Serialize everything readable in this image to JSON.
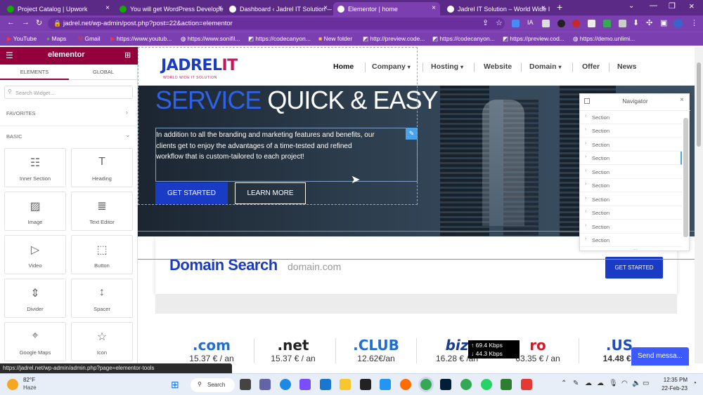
{
  "browser": {
    "tabs": [
      {
        "title": "Project Catalog | Upwork",
        "color": "#14a800"
      },
      {
        "title": "You will get WordPress Develope",
        "color": "#14a800"
      },
      {
        "title": "Dashboard ‹ Jadrel IT Solution —",
        "color": "#3c5a99"
      },
      {
        "title": "Elementor | home",
        "color": "#3c5a99"
      },
      {
        "title": "Jadrel IT Solution – World Wide I",
        "color": "#3c5a99"
      }
    ],
    "url": "jadrel.net/wp-admin/post.php?post=22&action=elementor",
    "bookmarks": [
      "YouTube",
      "Maps",
      "Gmail",
      "https://www.youtub...",
      "https://www.sonifil...",
      "https://codecanyon...",
      "New folder",
      "http://preview.code...",
      "https://codecanyon...",
      "https://preview.cod...",
      "https://demo.unlimi..."
    ]
  },
  "elementor": {
    "brand": "elementor",
    "tabs": [
      "ELEMENTS",
      "GLOBAL"
    ],
    "search_placeholder": "Search Widget...",
    "favorites_label": "FAVORITES",
    "basic_label": "BASIC",
    "widgets": [
      "Inner Section",
      "Heading",
      "Image",
      "Text Editor",
      "Video",
      "Button",
      "Divider",
      "Spacer",
      "Google Maps",
      "Icon"
    ]
  },
  "site": {
    "logo_main": "JADREL",
    "logo_accent": "IT",
    "logo_tagline": "WORLD WIDE IT SOLUTION",
    "nav": [
      "Home",
      "Company",
      "Hosting",
      "Website",
      "Domain",
      "Offer",
      "News"
    ],
    "hero": {
      "title_a": "SERVICE",
      "title_b": "QUICK & EASY",
      "body": "In addition to all the branding and marketing features and benefits, our clients get to enjoy the advantages of a time-tested and refined workflow that is custom-tailored to each project!",
      "cta_primary": "GET STARTED",
      "cta_secondary": "LEARN MORE"
    },
    "domain_search": {
      "title": "Domain Search",
      "placeholder": "domain.com",
      "button": "GET STARTED"
    },
    "tlds": [
      {
        "name": ".com",
        "price": "15.37 € / an",
        "color": "#1f6fd1"
      },
      {
        "name": ".net",
        "price": "15.37 € / an",
        "color": "#222222"
      },
      {
        "name": ".CLUB",
        "price": "12.62€/an",
        "color": "#1f6fd1"
      },
      {
        "name": "biz",
        "price": "16.28 € /an",
        "color": "#1a3c8f"
      },
      {
        "name": "ro",
        "price": "63.35 € / an",
        "color": "#d11a2a"
      },
      {
        "name": ".US",
        "price": "14.48 € /",
        "color": "#1f4fb5"
      }
    ],
    "speed_up": "↑ 69.4 Kbps",
    "speed_down": "↓ 44.3 Kbps",
    "chat_button": "Send messa..."
  },
  "navigator": {
    "title": "Navigator",
    "rows": [
      "Section",
      "Section",
      "Section",
      "Section",
      "Section",
      "Section",
      "Section",
      "Section",
      "Section",
      "Section"
    ]
  },
  "status_url": "https://jadrel.net/wp-admin/admin.php?page=elementor-tools",
  "taskbar": {
    "weather_temp": "82°F",
    "weather_desc": "Haze",
    "search_label": "Search",
    "time": "12:35 PM",
    "date": "22-Feb-23"
  },
  "colors": {
    "accent": "#93003c",
    "brand_blue": "#1a3cc4",
    "browser_purple": "#7b3fb0"
  }
}
